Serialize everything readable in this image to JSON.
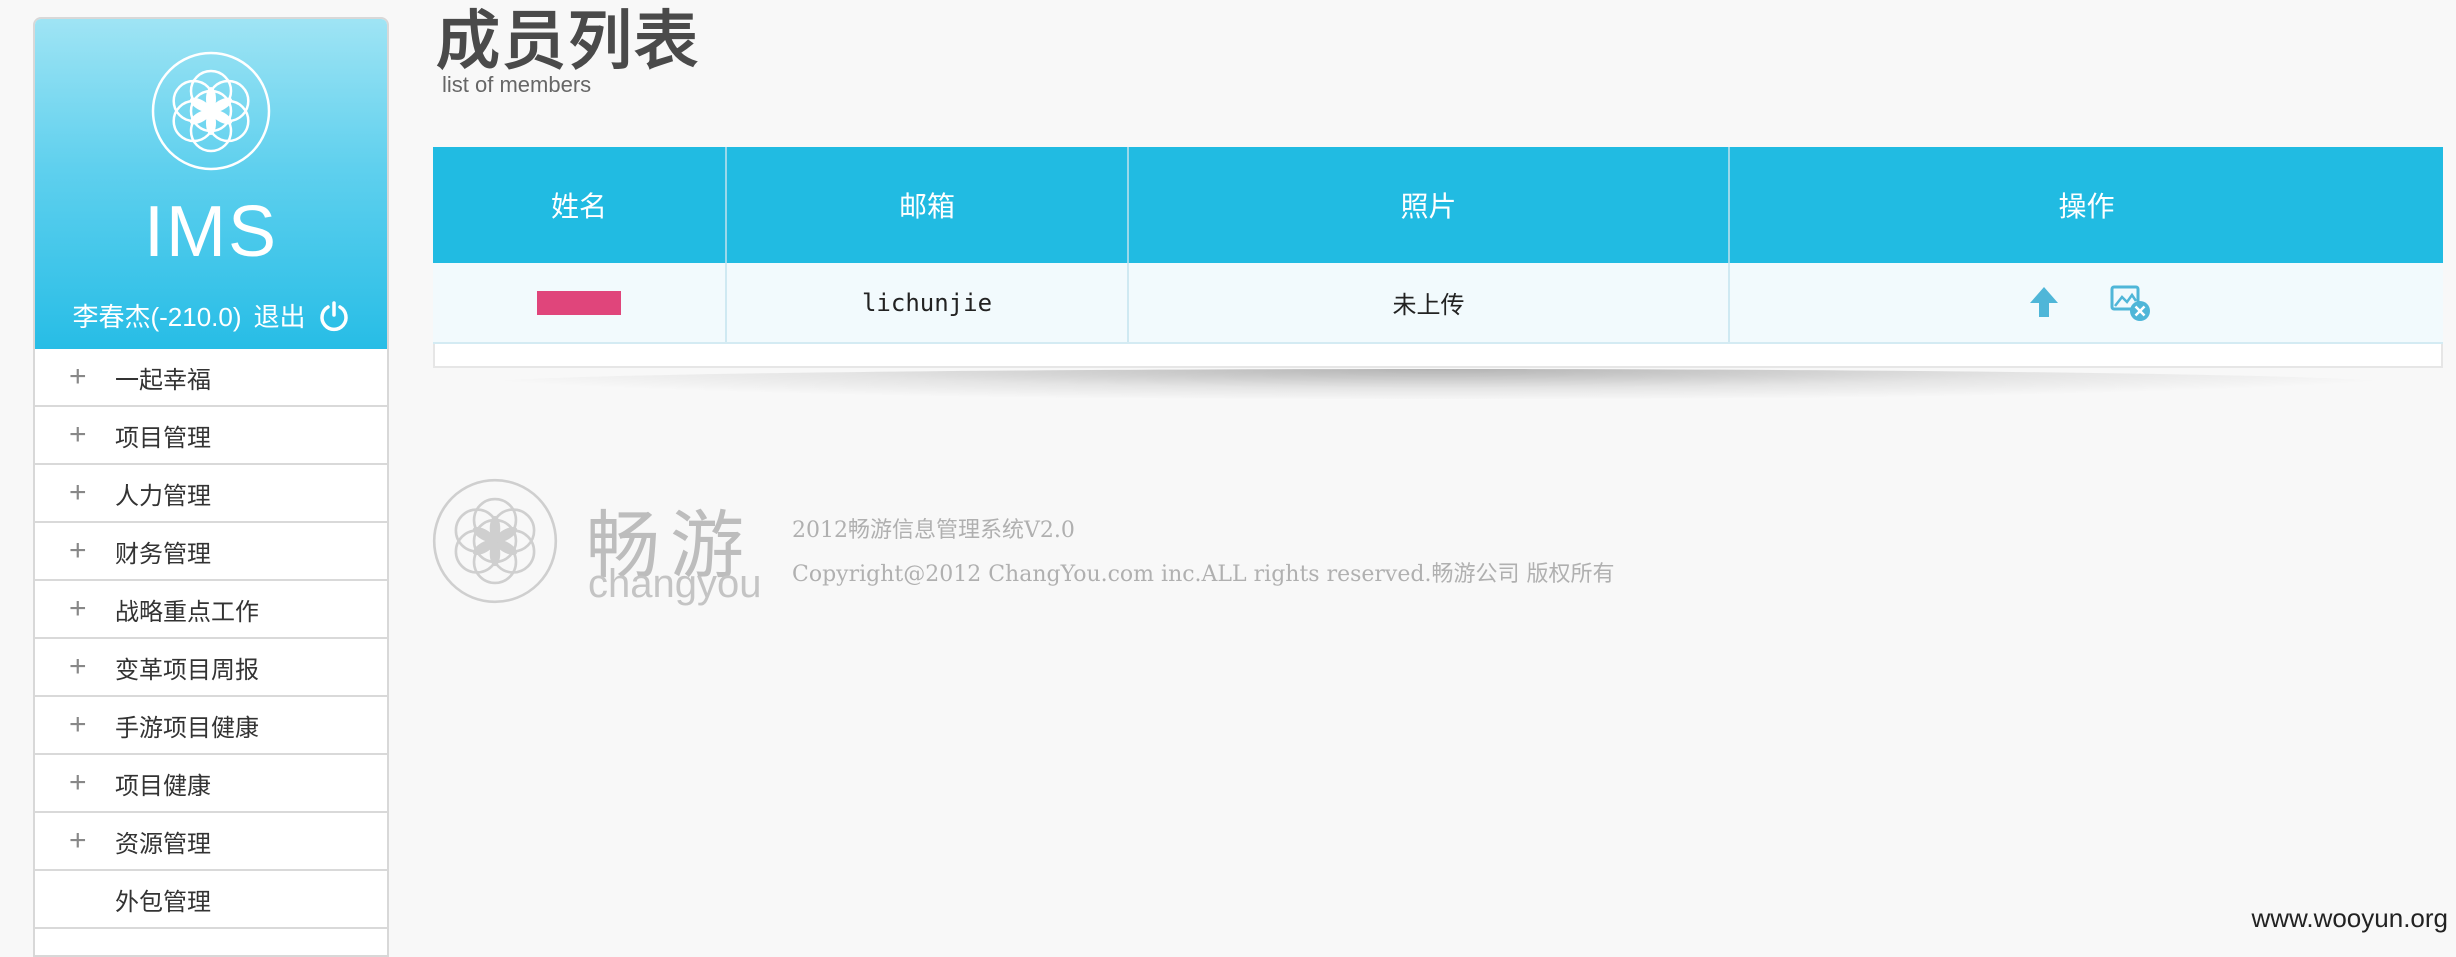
{
  "app": {
    "logo_text": "IMS",
    "user_display": "李春杰(-210.0)",
    "logout_label": "退出"
  },
  "sidebar": {
    "items": [
      {
        "label": "一起幸福",
        "expandable": true
      },
      {
        "label": "项目管理",
        "expandable": true
      },
      {
        "label": "人力管理",
        "expandable": true
      },
      {
        "label": "财务管理",
        "expandable": true
      },
      {
        "label": "战略重点工作",
        "expandable": true
      },
      {
        "label": "变革项目周报",
        "expandable": true
      },
      {
        "label": "手游项目健康",
        "expandable": true
      },
      {
        "label": "项目健康",
        "expandable": true
      },
      {
        "label": "资源管理",
        "expandable": true
      },
      {
        "label": "外包管理",
        "expandable": false
      }
    ]
  },
  "page": {
    "title": "成员列表",
    "subtitle": "list of members"
  },
  "table": {
    "headers": [
      "姓名",
      "邮箱",
      "照片",
      "操作"
    ],
    "rows": [
      {
        "name": "",
        "email": "lichunjie",
        "photo": "未上传",
        "actions": [
          "upload-arrow-icon",
          "delete-photo-icon"
        ]
      }
    ]
  },
  "footer": {
    "brand_cn": "畅游",
    "brand_en": "changyou",
    "line1": "2012畅游信息管理系统V2.0",
    "line2": "Copyright@2012 ChangYou.com inc.ALL rights reserved.畅游公司 版权所有"
  },
  "watermark": "www.wooyun.org",
  "colors": {
    "accent": "#21bbe2",
    "header_gradient_top": "#9fe4f4",
    "redaction": "#e0457b"
  }
}
